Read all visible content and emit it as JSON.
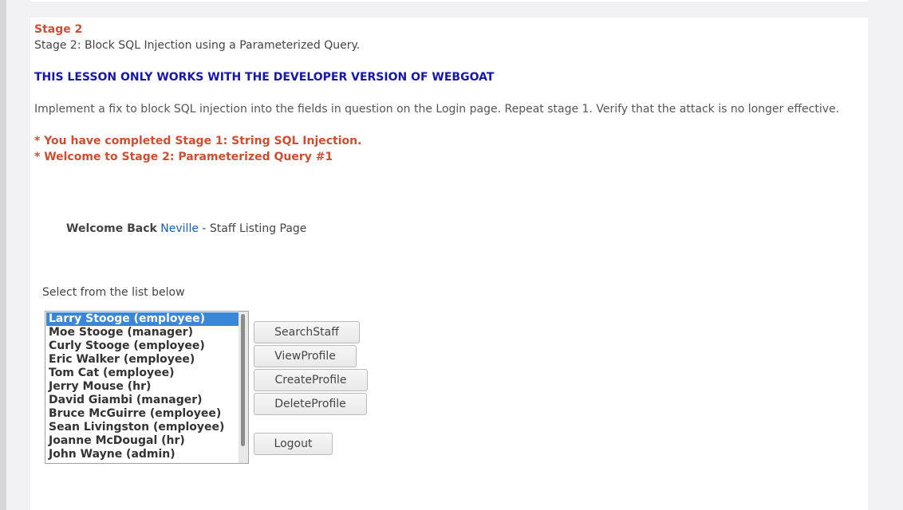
{
  "lesson": {
    "stage_title": "Stage 2",
    "stage_subtitle": "Stage 2: Block SQL Injection using a Parameterized Query.",
    "warning": "THIS LESSON ONLY WORKS WITH THE DEVELOPER VERSION OF WEBGOAT",
    "instructions": "Implement a fix to block SQL injection into the fields in question on the Login page. Repeat stage 1. Verify that the attack is no longer effective.",
    "completed_message": "* You have completed Stage 1: String SQL Injection.",
    "welcome_message": "* Welcome to Stage 2: Parameterized Query #1"
  },
  "header": {
    "welcome_prefix": "Welcome Back",
    "user_name": "Neville",
    "page_suffix": " - Staff Listing Page"
  },
  "staff_list": {
    "label": "Select from the list below",
    "selected_index": 0,
    "items": [
      "Larry Stooge (employee)",
      "Moe Stooge (manager)",
      "Curly Stooge (employee)",
      "Eric Walker (employee)",
      "Tom Cat (employee)",
      "Jerry Mouse (hr)",
      "David Giambi (manager)",
      "Bruce McGuirre (employee)",
      "Sean Livingston (employee)",
      "Joanne McDougal (hr)",
      "John Wayne (admin)"
    ]
  },
  "buttons": {
    "search_staff": "SearchStaff",
    "view_profile": "ViewProfile",
    "create_profile": "CreateProfile",
    "delete_profile": "DeleteProfile",
    "logout": "Logout"
  },
  "colors": {
    "stage_red": "#d14d32",
    "warning_blue": "#1515b3",
    "link_blue": "#1a5fb4",
    "selection_blue": "#3a87d8"
  }
}
